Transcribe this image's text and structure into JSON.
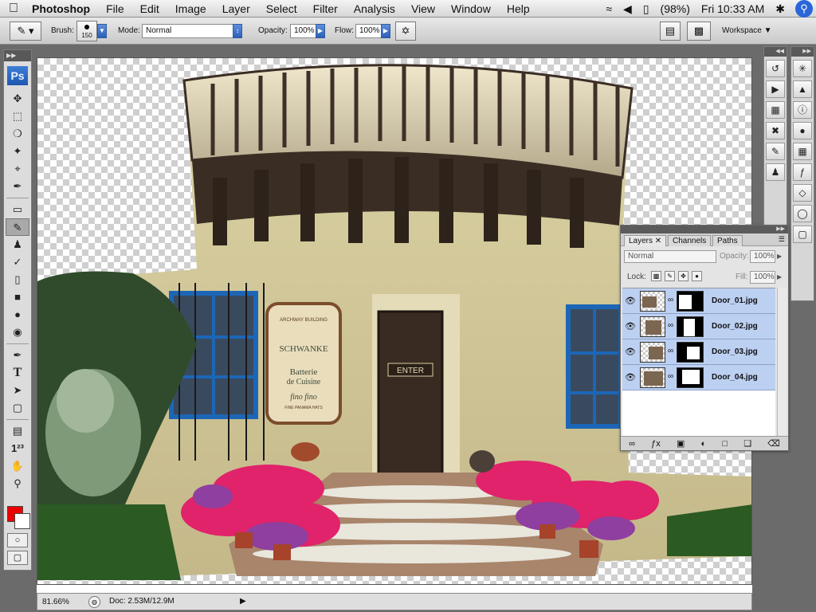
{
  "menubar": {
    "app_name": "Photoshop",
    "items": [
      "File",
      "Edit",
      "Image",
      "Layer",
      "Select",
      "Filter",
      "Analysis",
      "View",
      "Window",
      "Help"
    ],
    "battery": "(98%)",
    "clock": "Fri 10:33 AM"
  },
  "options": {
    "brush_label": "Brush:",
    "brush_size": "150",
    "mode_label": "Mode:",
    "mode_value": "Normal",
    "opacity_label": "Opacity:",
    "opacity_value": "100%",
    "flow_label": "Flow:",
    "flow_value": "100%",
    "workspace_label": "Workspace"
  },
  "tools": {
    "logo": "Ps",
    "foreground_color": "#ee0000",
    "background_color": "#ffffff"
  },
  "document": {
    "zoom": "81.66%",
    "doc_size": "Doc: 2.53M/12.9M"
  },
  "layers_panel": {
    "tabs": [
      "Layers",
      "Channels",
      "Paths"
    ],
    "blend_mode": "Normal",
    "opacity_label": "Opacity:",
    "opacity_value": "100%",
    "lock_label": "Lock:",
    "fill_label": "Fill:",
    "fill_value": "100%",
    "layers": [
      {
        "name": "Door_01.jpg"
      },
      {
        "name": "Door_02.jpg"
      },
      {
        "name": "Door_03.jpg"
      },
      {
        "name": "Door_04.jpg"
      }
    ]
  },
  "photo_sign": {
    "line1": "ARCHWAY BUILDING",
    "line2": "SCHWANKE",
    "line3": "Batterie",
    "line4": "de Cuisine",
    "line5": "fino fino",
    "line6": "FINE PANAMA HATS",
    "door_sign": "ENTER"
  }
}
